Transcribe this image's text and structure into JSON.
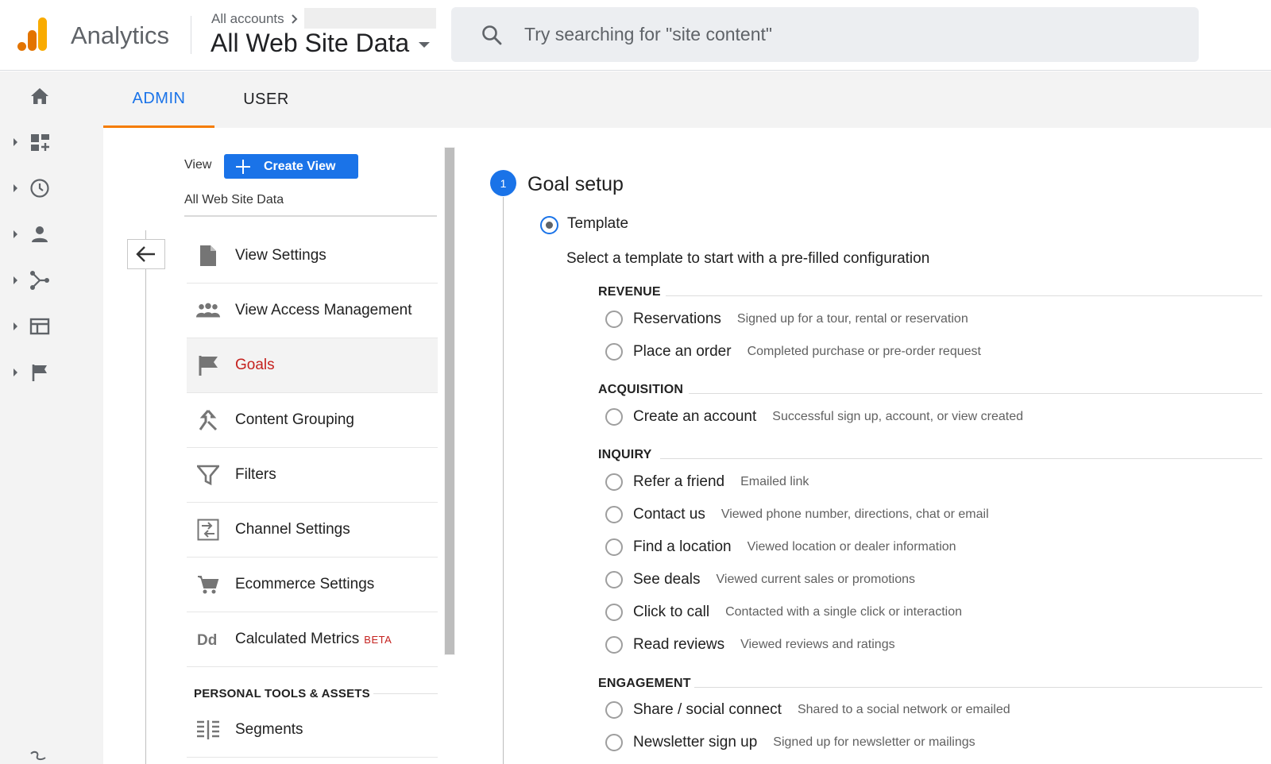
{
  "header": {
    "app_name": "Analytics",
    "account_breadcrumb": "All accounts",
    "current_view": "All Web Site Data",
    "search_placeholder": "Try searching for \"site content\""
  },
  "tabs": [
    {
      "label": "ADMIN",
      "active": true
    },
    {
      "label": "USER",
      "active": false
    }
  ],
  "rail_icons": [
    "home-icon",
    "dashboards-icon",
    "realtime-icon",
    "audience-icon",
    "acquisition-icon",
    "behavior-icon",
    "conversions-icon"
  ],
  "admin": {
    "view_label": "View",
    "create_view_label": "Create View",
    "view_name": "All Web Site Data",
    "nav": [
      {
        "label": "View Settings",
        "icon": "document-icon",
        "active": false
      },
      {
        "label": "View Access Management",
        "icon": "people-icon",
        "active": false
      },
      {
        "label": "Goals",
        "icon": "flag-icon",
        "active": true
      },
      {
        "label": "Content Grouping",
        "icon": "content-grouping-icon",
        "active": false
      },
      {
        "label": "Filters",
        "icon": "filter-icon",
        "active": false
      },
      {
        "label": "Channel Settings",
        "icon": "channel-icon",
        "active": false
      },
      {
        "label": "Ecommerce Settings",
        "icon": "cart-icon",
        "active": false
      },
      {
        "label": "Calculated Metrics",
        "icon": "dd-icon",
        "active": false,
        "badge": "BETA"
      }
    ],
    "personal_tools_header": "PERSONAL TOOLS & ASSETS",
    "segments_label": "Segments"
  },
  "goal_setup": {
    "step_number": "1",
    "title": "Goal setup",
    "template_label": "Template",
    "template_desc": "Select a template to start with a pre-filled configuration",
    "categories": [
      {
        "name": "REVENUE",
        "options": [
          {
            "label": "Reservations",
            "desc": "Signed up for a tour, rental or reservation"
          },
          {
            "label": "Place an order",
            "desc": "Completed purchase or pre-order request"
          }
        ]
      },
      {
        "name": "ACQUISITION",
        "options": [
          {
            "label": "Create an account",
            "desc": "Successful sign up, account, or view created"
          }
        ]
      },
      {
        "name": "INQUIRY",
        "options": [
          {
            "label": "Refer a friend",
            "desc": "Emailed link"
          },
          {
            "label": "Contact us",
            "desc": "Viewed phone number, directions, chat or email"
          },
          {
            "label": "Find a location",
            "desc": "Viewed location or dealer information"
          },
          {
            "label": "See deals",
            "desc": "Viewed current sales or promotions"
          },
          {
            "label": "Click to call",
            "desc": "Contacted with a single click or interaction"
          },
          {
            "label": "Read reviews",
            "desc": "Viewed reviews and ratings"
          }
        ]
      },
      {
        "name": "ENGAGEMENT",
        "options": [
          {
            "label": "Share / social connect",
            "desc": "Shared to a social network or emailed"
          },
          {
            "label": "Newsletter sign up",
            "desc": "Signed up for newsletter or mailings"
          }
        ]
      }
    ]
  },
  "colors": {
    "accent": "#1a73e8",
    "active_nav": "#c5221f",
    "tab_underline": "#f57c00"
  }
}
